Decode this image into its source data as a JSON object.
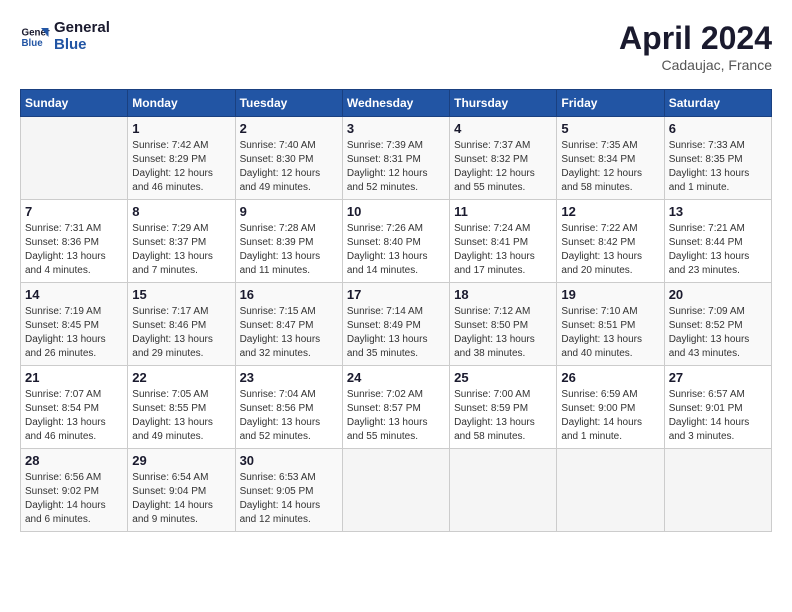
{
  "header": {
    "logo_line1": "General",
    "logo_line2": "Blue",
    "month": "April 2024",
    "location": "Cadaujac, France"
  },
  "weekdays": [
    "Sunday",
    "Monday",
    "Tuesday",
    "Wednesday",
    "Thursday",
    "Friday",
    "Saturday"
  ],
  "weeks": [
    [
      {
        "day": "",
        "info": ""
      },
      {
        "day": "1",
        "info": "Sunrise: 7:42 AM\nSunset: 8:29 PM\nDaylight: 12 hours\nand 46 minutes."
      },
      {
        "day": "2",
        "info": "Sunrise: 7:40 AM\nSunset: 8:30 PM\nDaylight: 12 hours\nand 49 minutes."
      },
      {
        "day": "3",
        "info": "Sunrise: 7:39 AM\nSunset: 8:31 PM\nDaylight: 12 hours\nand 52 minutes."
      },
      {
        "day": "4",
        "info": "Sunrise: 7:37 AM\nSunset: 8:32 PM\nDaylight: 12 hours\nand 55 minutes."
      },
      {
        "day": "5",
        "info": "Sunrise: 7:35 AM\nSunset: 8:34 PM\nDaylight: 12 hours\nand 58 minutes."
      },
      {
        "day": "6",
        "info": "Sunrise: 7:33 AM\nSunset: 8:35 PM\nDaylight: 13 hours\nand 1 minute."
      }
    ],
    [
      {
        "day": "7",
        "info": "Sunrise: 7:31 AM\nSunset: 8:36 PM\nDaylight: 13 hours\nand 4 minutes."
      },
      {
        "day": "8",
        "info": "Sunrise: 7:29 AM\nSunset: 8:37 PM\nDaylight: 13 hours\nand 7 minutes."
      },
      {
        "day": "9",
        "info": "Sunrise: 7:28 AM\nSunset: 8:39 PM\nDaylight: 13 hours\nand 11 minutes."
      },
      {
        "day": "10",
        "info": "Sunrise: 7:26 AM\nSunset: 8:40 PM\nDaylight: 13 hours\nand 14 minutes."
      },
      {
        "day": "11",
        "info": "Sunrise: 7:24 AM\nSunset: 8:41 PM\nDaylight: 13 hours\nand 17 minutes."
      },
      {
        "day": "12",
        "info": "Sunrise: 7:22 AM\nSunset: 8:42 PM\nDaylight: 13 hours\nand 20 minutes."
      },
      {
        "day": "13",
        "info": "Sunrise: 7:21 AM\nSunset: 8:44 PM\nDaylight: 13 hours\nand 23 minutes."
      }
    ],
    [
      {
        "day": "14",
        "info": "Sunrise: 7:19 AM\nSunset: 8:45 PM\nDaylight: 13 hours\nand 26 minutes."
      },
      {
        "day": "15",
        "info": "Sunrise: 7:17 AM\nSunset: 8:46 PM\nDaylight: 13 hours\nand 29 minutes."
      },
      {
        "day": "16",
        "info": "Sunrise: 7:15 AM\nSunset: 8:47 PM\nDaylight: 13 hours\nand 32 minutes."
      },
      {
        "day": "17",
        "info": "Sunrise: 7:14 AM\nSunset: 8:49 PM\nDaylight: 13 hours\nand 35 minutes."
      },
      {
        "day": "18",
        "info": "Sunrise: 7:12 AM\nSunset: 8:50 PM\nDaylight: 13 hours\nand 38 minutes."
      },
      {
        "day": "19",
        "info": "Sunrise: 7:10 AM\nSunset: 8:51 PM\nDaylight: 13 hours\nand 40 minutes."
      },
      {
        "day": "20",
        "info": "Sunrise: 7:09 AM\nSunset: 8:52 PM\nDaylight: 13 hours\nand 43 minutes."
      }
    ],
    [
      {
        "day": "21",
        "info": "Sunrise: 7:07 AM\nSunset: 8:54 PM\nDaylight: 13 hours\nand 46 minutes."
      },
      {
        "day": "22",
        "info": "Sunrise: 7:05 AM\nSunset: 8:55 PM\nDaylight: 13 hours\nand 49 minutes."
      },
      {
        "day": "23",
        "info": "Sunrise: 7:04 AM\nSunset: 8:56 PM\nDaylight: 13 hours\nand 52 minutes."
      },
      {
        "day": "24",
        "info": "Sunrise: 7:02 AM\nSunset: 8:57 PM\nDaylight: 13 hours\nand 55 minutes."
      },
      {
        "day": "25",
        "info": "Sunrise: 7:00 AM\nSunset: 8:59 PM\nDaylight: 13 hours\nand 58 minutes."
      },
      {
        "day": "26",
        "info": "Sunrise: 6:59 AM\nSunset: 9:00 PM\nDaylight: 14 hours\nand 1 minute."
      },
      {
        "day": "27",
        "info": "Sunrise: 6:57 AM\nSunset: 9:01 PM\nDaylight: 14 hours\nand 3 minutes."
      }
    ],
    [
      {
        "day": "28",
        "info": "Sunrise: 6:56 AM\nSunset: 9:02 PM\nDaylight: 14 hours\nand 6 minutes."
      },
      {
        "day": "29",
        "info": "Sunrise: 6:54 AM\nSunset: 9:04 PM\nDaylight: 14 hours\nand 9 minutes."
      },
      {
        "day": "30",
        "info": "Sunrise: 6:53 AM\nSunset: 9:05 PM\nDaylight: 14 hours\nand 12 minutes."
      },
      {
        "day": "",
        "info": ""
      },
      {
        "day": "",
        "info": ""
      },
      {
        "day": "",
        "info": ""
      },
      {
        "day": "",
        "info": ""
      }
    ]
  ]
}
